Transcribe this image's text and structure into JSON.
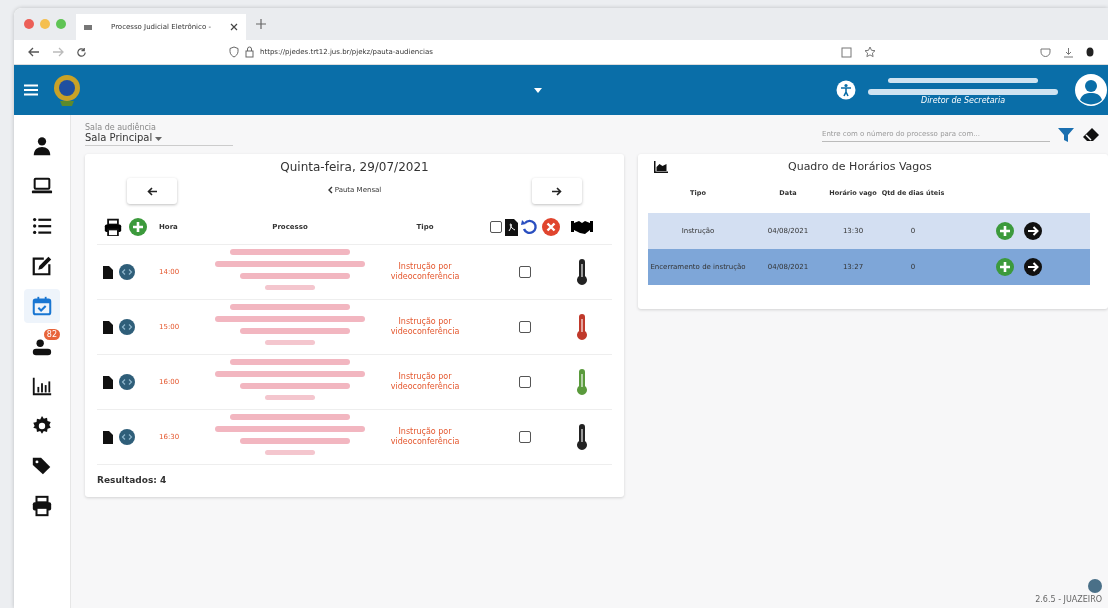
{
  "browser": {
    "tab_title": "Processo Judicial Eletrônico - ",
    "url": "https://pjedes.trt12.jus.br/pjekz/pauta-audiencias"
  },
  "header": {
    "role": "Diretor de Secretaria"
  },
  "sidebar": {
    "items": [
      {
        "selected": false
      },
      {
        "selected": false
      },
      {
        "selected": false
      },
      {
        "selected": false
      },
      {
        "selected": true
      },
      {
        "selected": false,
        "badge": "82"
      },
      {
        "selected": false
      },
      {
        "selected": false
      },
      {
        "selected": false
      },
      {
        "selected": false
      }
    ]
  },
  "room": {
    "label": "Sala de audiência",
    "value": "Sala Principal"
  },
  "search": {
    "placeholder": "Entre com o número do processo para com..."
  },
  "agenda": {
    "date": "Quinta-feira, 29/07/2021",
    "monthly_link": "Pauta Mensal",
    "columns": [
      "Hora",
      "Processo",
      "Tipo"
    ],
    "select_all_checked": false,
    "rows": [
      {
        "hora": "14:00",
        "tipo": "Instrução por videoconferência",
        "checked": false,
        "color": "#222222"
      },
      {
        "hora": "15:00",
        "tipo": "Instrução por videoconferência",
        "checked": false,
        "color": "#c0392b"
      },
      {
        "hora": "16:00",
        "tipo": "Instrução por videoconferência",
        "checked": false,
        "color": "#5a9a3c"
      },
      {
        "hora": "16:30",
        "tipo": "Instrução por videoconferência",
        "checked": false,
        "color": "#222222"
      }
    ],
    "results": "Resultados: 4"
  },
  "vacancies": {
    "title": "Quadro de Horários Vagos",
    "columns": [
      "Tipo",
      "Data",
      "Horário vago",
      "Qtd de dias úteis"
    ],
    "rows": [
      {
        "tipo": "Instrução",
        "data": "04/08/2021",
        "horario": "13:30",
        "dias": "0",
        "selected": false
      },
      {
        "tipo": "Encerramento de instrução",
        "data": "04/08/2021",
        "horario": "13:27",
        "dias": "0",
        "selected": true
      }
    ]
  },
  "version": "2.6.5 - JUAZEIRO"
}
